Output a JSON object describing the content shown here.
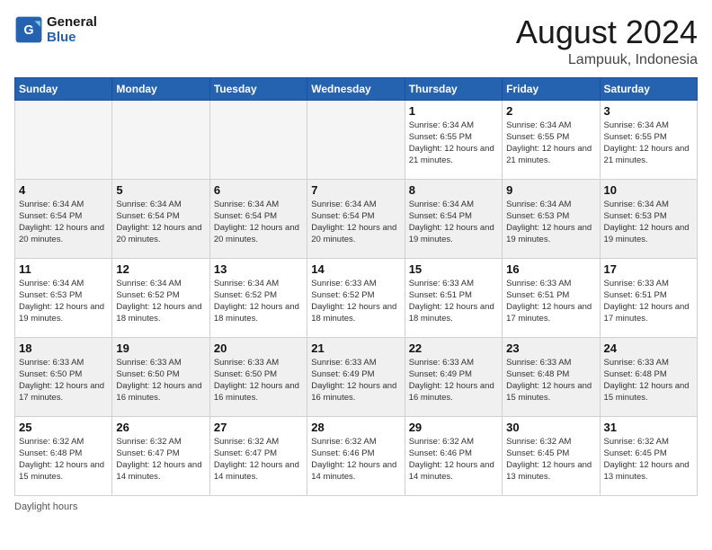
{
  "header": {
    "logo_line1": "General",
    "logo_line2": "Blue",
    "month_year": "August 2024",
    "location": "Lampuuk, Indonesia"
  },
  "days_of_week": [
    "Sunday",
    "Monday",
    "Tuesday",
    "Wednesday",
    "Thursday",
    "Friday",
    "Saturday"
  ],
  "footer": {
    "daylight_label": "Daylight hours"
  },
  "weeks": [
    [
      {
        "day": "",
        "sunrise": "",
        "sunset": "",
        "daylight": "",
        "empty": true
      },
      {
        "day": "",
        "sunrise": "",
        "sunset": "",
        "daylight": "",
        "empty": true
      },
      {
        "day": "",
        "sunrise": "",
        "sunset": "",
        "daylight": "",
        "empty": true
      },
      {
        "day": "",
        "sunrise": "",
        "sunset": "",
        "daylight": "",
        "empty": true
      },
      {
        "day": "1",
        "sunrise": "Sunrise: 6:34 AM",
        "sunset": "Sunset: 6:55 PM",
        "daylight": "Daylight: 12 hours and 21 minutes.",
        "empty": false
      },
      {
        "day": "2",
        "sunrise": "Sunrise: 6:34 AM",
        "sunset": "Sunset: 6:55 PM",
        "daylight": "Daylight: 12 hours and 21 minutes.",
        "empty": false
      },
      {
        "day": "3",
        "sunrise": "Sunrise: 6:34 AM",
        "sunset": "Sunset: 6:55 PM",
        "daylight": "Daylight: 12 hours and 21 minutes.",
        "empty": false
      }
    ],
    [
      {
        "day": "4",
        "sunrise": "Sunrise: 6:34 AM",
        "sunset": "Sunset: 6:54 PM",
        "daylight": "Daylight: 12 hours and 20 minutes.",
        "empty": false
      },
      {
        "day": "5",
        "sunrise": "Sunrise: 6:34 AM",
        "sunset": "Sunset: 6:54 PM",
        "daylight": "Daylight: 12 hours and 20 minutes.",
        "empty": false
      },
      {
        "day": "6",
        "sunrise": "Sunrise: 6:34 AM",
        "sunset": "Sunset: 6:54 PM",
        "daylight": "Daylight: 12 hours and 20 minutes.",
        "empty": false
      },
      {
        "day": "7",
        "sunrise": "Sunrise: 6:34 AM",
        "sunset": "Sunset: 6:54 PM",
        "daylight": "Daylight: 12 hours and 20 minutes.",
        "empty": false
      },
      {
        "day": "8",
        "sunrise": "Sunrise: 6:34 AM",
        "sunset": "Sunset: 6:54 PM",
        "daylight": "Daylight: 12 hours and 19 minutes.",
        "empty": false
      },
      {
        "day": "9",
        "sunrise": "Sunrise: 6:34 AM",
        "sunset": "Sunset: 6:53 PM",
        "daylight": "Daylight: 12 hours and 19 minutes.",
        "empty": false
      },
      {
        "day": "10",
        "sunrise": "Sunrise: 6:34 AM",
        "sunset": "Sunset: 6:53 PM",
        "daylight": "Daylight: 12 hours and 19 minutes.",
        "empty": false
      }
    ],
    [
      {
        "day": "11",
        "sunrise": "Sunrise: 6:34 AM",
        "sunset": "Sunset: 6:53 PM",
        "daylight": "Daylight: 12 hours and 19 minutes.",
        "empty": false
      },
      {
        "day": "12",
        "sunrise": "Sunrise: 6:34 AM",
        "sunset": "Sunset: 6:52 PM",
        "daylight": "Daylight: 12 hours and 18 minutes.",
        "empty": false
      },
      {
        "day": "13",
        "sunrise": "Sunrise: 6:34 AM",
        "sunset": "Sunset: 6:52 PM",
        "daylight": "Daylight: 12 hours and 18 minutes.",
        "empty": false
      },
      {
        "day": "14",
        "sunrise": "Sunrise: 6:33 AM",
        "sunset": "Sunset: 6:52 PM",
        "daylight": "Daylight: 12 hours and 18 minutes.",
        "empty": false
      },
      {
        "day": "15",
        "sunrise": "Sunrise: 6:33 AM",
        "sunset": "Sunset: 6:51 PM",
        "daylight": "Daylight: 12 hours and 18 minutes.",
        "empty": false
      },
      {
        "day": "16",
        "sunrise": "Sunrise: 6:33 AM",
        "sunset": "Sunset: 6:51 PM",
        "daylight": "Daylight: 12 hours and 17 minutes.",
        "empty": false
      },
      {
        "day": "17",
        "sunrise": "Sunrise: 6:33 AM",
        "sunset": "Sunset: 6:51 PM",
        "daylight": "Daylight: 12 hours and 17 minutes.",
        "empty": false
      }
    ],
    [
      {
        "day": "18",
        "sunrise": "Sunrise: 6:33 AM",
        "sunset": "Sunset: 6:50 PM",
        "daylight": "Daylight: 12 hours and 17 minutes.",
        "empty": false
      },
      {
        "day": "19",
        "sunrise": "Sunrise: 6:33 AM",
        "sunset": "Sunset: 6:50 PM",
        "daylight": "Daylight: 12 hours and 16 minutes.",
        "empty": false
      },
      {
        "day": "20",
        "sunrise": "Sunrise: 6:33 AM",
        "sunset": "Sunset: 6:50 PM",
        "daylight": "Daylight: 12 hours and 16 minutes.",
        "empty": false
      },
      {
        "day": "21",
        "sunrise": "Sunrise: 6:33 AM",
        "sunset": "Sunset: 6:49 PM",
        "daylight": "Daylight: 12 hours and 16 minutes.",
        "empty": false
      },
      {
        "day": "22",
        "sunrise": "Sunrise: 6:33 AM",
        "sunset": "Sunset: 6:49 PM",
        "daylight": "Daylight: 12 hours and 16 minutes.",
        "empty": false
      },
      {
        "day": "23",
        "sunrise": "Sunrise: 6:33 AM",
        "sunset": "Sunset: 6:48 PM",
        "daylight": "Daylight: 12 hours and 15 minutes.",
        "empty": false
      },
      {
        "day": "24",
        "sunrise": "Sunrise: 6:33 AM",
        "sunset": "Sunset: 6:48 PM",
        "daylight": "Daylight: 12 hours and 15 minutes.",
        "empty": false
      }
    ],
    [
      {
        "day": "25",
        "sunrise": "Sunrise: 6:32 AM",
        "sunset": "Sunset: 6:48 PM",
        "daylight": "Daylight: 12 hours and 15 minutes.",
        "empty": false
      },
      {
        "day": "26",
        "sunrise": "Sunrise: 6:32 AM",
        "sunset": "Sunset: 6:47 PM",
        "daylight": "Daylight: 12 hours and 14 minutes.",
        "empty": false
      },
      {
        "day": "27",
        "sunrise": "Sunrise: 6:32 AM",
        "sunset": "Sunset: 6:47 PM",
        "daylight": "Daylight: 12 hours and 14 minutes.",
        "empty": false
      },
      {
        "day": "28",
        "sunrise": "Sunrise: 6:32 AM",
        "sunset": "Sunset: 6:46 PM",
        "daylight": "Daylight: 12 hours and 14 minutes.",
        "empty": false
      },
      {
        "day": "29",
        "sunrise": "Sunrise: 6:32 AM",
        "sunset": "Sunset: 6:46 PM",
        "daylight": "Daylight: 12 hours and 14 minutes.",
        "empty": false
      },
      {
        "day": "30",
        "sunrise": "Sunrise: 6:32 AM",
        "sunset": "Sunset: 6:45 PM",
        "daylight": "Daylight: 12 hours and 13 minutes.",
        "empty": false
      },
      {
        "day": "31",
        "sunrise": "Sunrise: 6:32 AM",
        "sunset": "Sunset: 6:45 PM",
        "daylight": "Daylight: 12 hours and 13 minutes.",
        "empty": false
      }
    ]
  ]
}
